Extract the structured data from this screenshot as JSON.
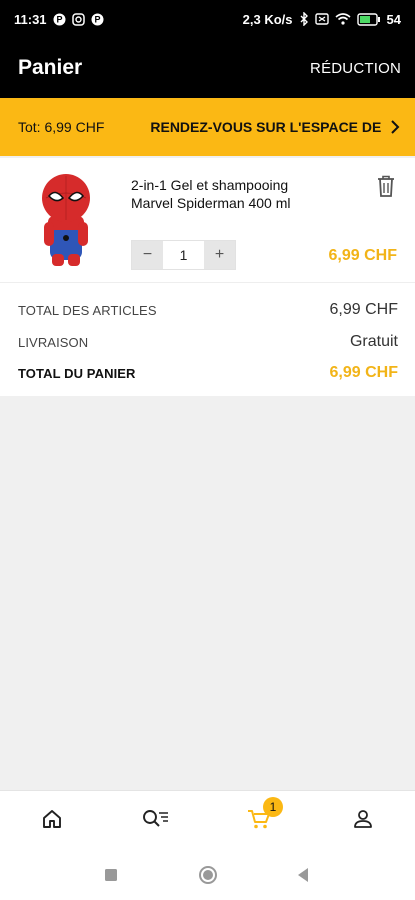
{
  "status_bar": {
    "time": "11:31",
    "network_speed": "2,3 Ko/s",
    "battery": "54",
    "icons": [
      "notification-p-icon",
      "instagram-icon",
      "notification-p-icon",
      "bluetooth-icon",
      "sim-icon",
      "wifi-icon",
      "battery-icon"
    ]
  },
  "header": {
    "title": "Panier",
    "reduction_label": "RÉDUCTION"
  },
  "banner": {
    "total": "Tot: 6,99 CHF",
    "link": "RENDEZ-VOUS SUR L'ESPACE DE",
    "icon": "chevron-right-icon"
  },
  "cart_item": {
    "name": "2-in-1 Gel et shampooing Marvel Spiderman 400 ml",
    "quantity": "1",
    "minus": "−",
    "plus": "+",
    "price": "6,99 CHF",
    "image": "spiderman-bottle-image",
    "delete_icon": "trash-icon"
  },
  "summary": {
    "articles_label": "TOTAL DES ARTICLES",
    "articles_value": "6,99 CHF",
    "delivery_label": "LIVRAISON",
    "delivery_value": "Gratuit",
    "total_label": "TOTAL DU PANIER",
    "total_value": "6,99 CHF"
  },
  "bottom_nav": {
    "items": [
      "home-icon",
      "search-list-icon",
      "cart-icon",
      "account-icon"
    ],
    "cart_badge": "1",
    "active_color": "#fbb814"
  },
  "system_nav": {
    "items": [
      "recents-square-icon",
      "home-circle-icon",
      "back-triangle-icon"
    ]
  },
  "colors": {
    "accent": "#fbb814",
    "price": "#f2b418",
    "header_bg": "#000000"
  }
}
